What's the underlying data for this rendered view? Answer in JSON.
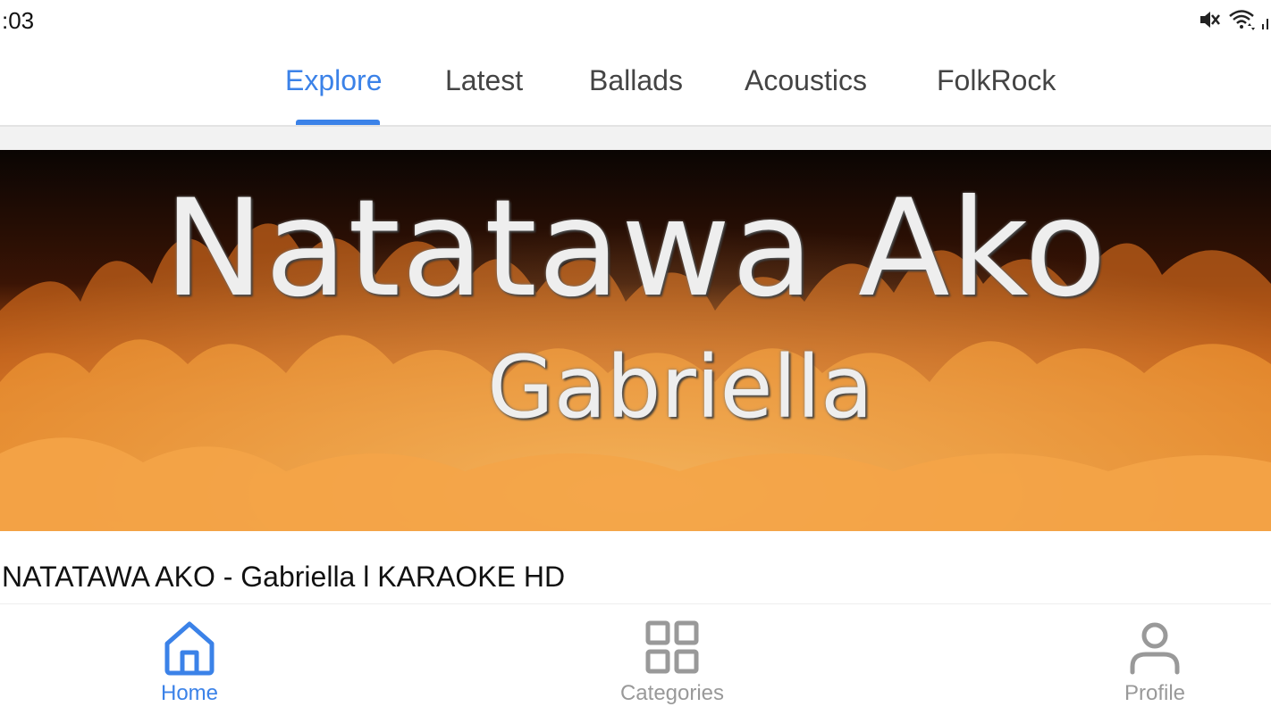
{
  "status_bar": {
    "time": ":03",
    "icons": [
      "mute-icon",
      "wifi-icon",
      "signal-icon"
    ]
  },
  "tabs": [
    {
      "label": "Explore",
      "active": true
    },
    {
      "label": "Latest",
      "active": false
    },
    {
      "label": "Ballads",
      "active": false
    },
    {
      "label": "Acoustics",
      "active": false
    },
    {
      "label": "FolkRock",
      "active": false
    }
  ],
  "video": {
    "thumbnail_title": "Natatawa Ako",
    "thumbnail_subtitle": "Gabriella",
    "title": "NATATAWA AKO - Gabriella l KARAOKE HD"
  },
  "bottom_nav": [
    {
      "label": "Home",
      "icon": "home-icon",
      "active": true
    },
    {
      "label": "Categories",
      "icon": "grid-icon",
      "active": false
    },
    {
      "label": "Profile",
      "icon": "user-icon",
      "active": false
    }
  ],
  "colors": {
    "accent": "#3b82e8",
    "inactive": "#999999"
  }
}
